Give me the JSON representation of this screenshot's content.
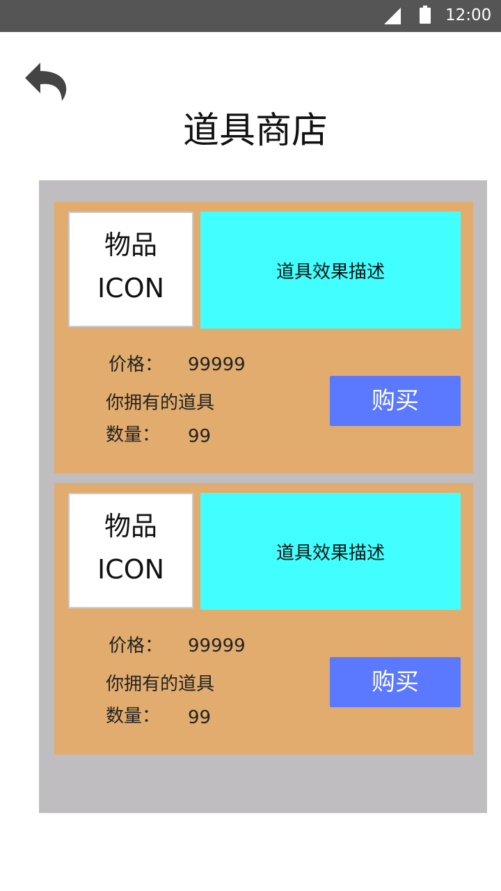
{
  "status_bar": {
    "time": "12:00",
    "icons": [
      "signal-icon",
      "battery-icon"
    ]
  },
  "header": {
    "back_icon": "back-arrow-icon",
    "title": "道具商店"
  },
  "items": [
    {
      "icon_text_line1": "物品",
      "icon_text_line2": "ICON",
      "description": "道具效果描述",
      "price_label": "价格：",
      "price": "99999",
      "owned_label": "你拥有的道具",
      "quantity_label": "数量：",
      "quantity": "99",
      "buy_label": "购买"
    },
    {
      "icon_text_line1": "物品",
      "icon_text_line2": "ICON",
      "description": "道具效果描述",
      "price_label": "价格：",
      "price": "99999",
      "owned_label": "你拥有的道具",
      "quantity_label": "数量：",
      "quantity": "99",
      "buy_label": "购买"
    }
  ],
  "colors": {
    "status_bar": "#555555",
    "panel": "#bfbdc0",
    "card": "#e1ac6e",
    "description_bg": "#41fffe",
    "buy_button": "#5a79fe"
  }
}
